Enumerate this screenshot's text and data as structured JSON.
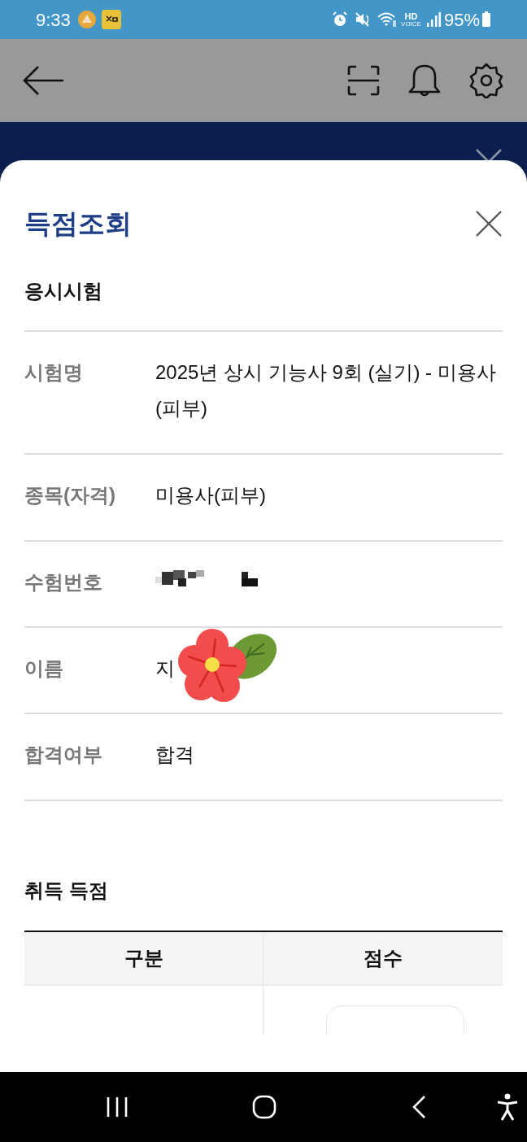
{
  "status_bar": {
    "time": "9:33",
    "hd": "HD",
    "voice": "VOICE",
    "battery": "95%"
  },
  "sheet": {
    "title": "득점조회",
    "exam_section": {
      "heading": "응시시험",
      "rows": [
        {
          "kind": "text",
          "label": "시험명",
          "value": "2025년 상시 기능사 9회 (실기) - 미용사(피부)"
        },
        {
          "kind": "text",
          "label": "종목(자격)",
          "value": "미용사(피부)"
        },
        {
          "kind": "redacted",
          "label": "수험번호"
        },
        {
          "kind": "covered",
          "label": "이름",
          "value": "지"
        },
        {
          "kind": "text",
          "label": "합격여부",
          "value": "합격"
        }
      ]
    },
    "score_section": {
      "heading": "취득 득점",
      "columns": [
        "구분",
        "점수"
      ]
    }
  }
}
